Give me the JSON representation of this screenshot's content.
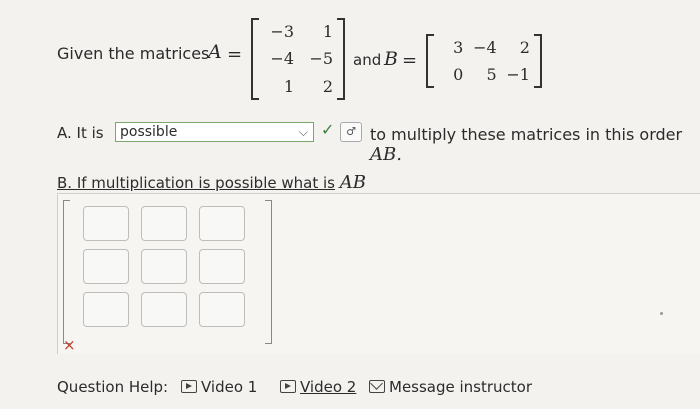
{
  "statement": {
    "given_label": "Given the matrices",
    "matrix_a_name": "A",
    "equals": "=",
    "matrix_a": [
      [
        "−3",
        "1"
      ],
      [
        "−4",
        "−5"
      ],
      [
        "1",
        "2"
      ]
    ],
    "and_label": "and",
    "matrix_b_name": "B",
    "matrix_b": [
      [
        "3",
        "−4",
        "2"
      ],
      [
        "0",
        "5",
        "−1"
      ]
    ]
  },
  "part_a": {
    "label": "A. It is",
    "select_value": "possible",
    "rest_text": "to multiply these matrices in this order",
    "product_name": "AB."
  },
  "part_b": {
    "label": "B. If multiplication is possible what is",
    "product_name": "AB",
    "answer_cells": [
      "",
      "",
      "",
      "",
      "",
      "",
      "",
      "",
      ""
    ]
  },
  "feedback": {
    "incorrect_mark": "×"
  },
  "help": {
    "label": "Question Help:",
    "video1": "Video 1",
    "video2": "Video 2",
    "message": "Message instructor"
  },
  "icons": {
    "check": "checkmark-icon",
    "attempt": "attempt-icon",
    "video": "play-icon",
    "message": "mail-icon"
  },
  "colors": {
    "correct": "#3f7f3f",
    "incorrect": "#c0392b",
    "select_border": "#7aa86a"
  }
}
